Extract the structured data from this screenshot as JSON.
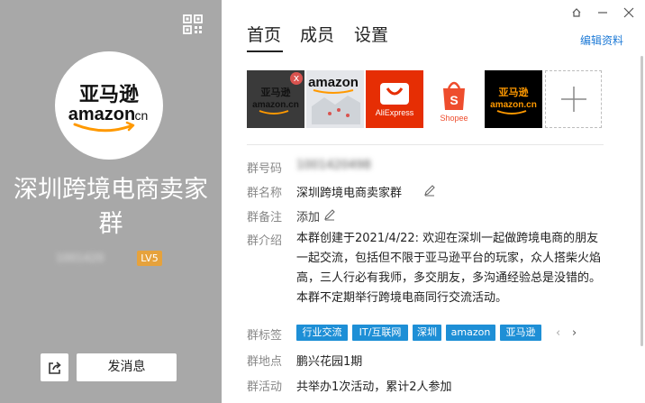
{
  "left": {
    "qr_icon": "qr-code-icon",
    "avatar": {
      "logo_cn": "亚马逊",
      "logo_en": "amazon",
      "logo_suffix": ".cn"
    },
    "group_title": "深圳跨境电商卖家群",
    "group_id": "1001420",
    "level": "LV5",
    "share_icon": "share-icon",
    "send_label": "发消息"
  },
  "window_controls": {
    "pin_icon": "pin-icon",
    "minimize_icon": "minimize-icon",
    "close_icon": "close-icon"
  },
  "tabs": [
    {
      "label": "首页",
      "active": true
    },
    {
      "label": "成员",
      "active": false
    },
    {
      "label": "设置",
      "active": false
    }
  ],
  "edit_label": "编辑资料",
  "photos": [
    {
      "kind": "amazon-cn-dark",
      "text_cn": "亚马逊",
      "text_en": "amazon.cn"
    },
    {
      "kind": "amazon-map",
      "text_en": "amazon"
    },
    {
      "kind": "aliexpress",
      "text_en": "AliExpress"
    },
    {
      "kind": "shopee",
      "text_en": "Shopee"
    },
    {
      "kind": "amazon-cn-black",
      "text_cn": "亚马逊",
      "text_en": "amazon.cn"
    }
  ],
  "photo_delete_icon": "x",
  "add_photo_icon": "plus-icon",
  "info": {
    "code": {
      "label": "群号码",
      "value": "1001420498"
    },
    "name": {
      "label": "群名称",
      "value": "深圳跨境电商卖家群",
      "edit_icon": "pencil-icon"
    },
    "remark": {
      "label": "群备注",
      "value": "添加",
      "edit_icon": "pencil-icon"
    },
    "intro": {
      "label": "群介绍",
      "value": "本群创建于2021/4/22: 欢迎在深圳一起做跨境电商的朋友一起交流，包括但不限于亚马逊平台的玩家，众人搭柴火焰高，三人行必有我师，多交朋友，多沟通经验总是没错的。本群不定期举行跨境电商同行交流活动。"
    },
    "tags": {
      "label": "群标签",
      "items": [
        "行业交流",
        "IT/互联网",
        "深圳",
        "amazon",
        "亚马逊"
      ]
    },
    "location": {
      "label": "群地点",
      "value": "鹏兴花园1期"
    },
    "activity": {
      "label": "群活动",
      "value": "共举办1次活动，累计2人参加"
    }
  },
  "colors": {
    "left_bg": "#a8a8a8",
    "accent": "#1e7ad6",
    "tag_bg": "#1e8fd6",
    "level_bg": "#e6a23c"
  }
}
